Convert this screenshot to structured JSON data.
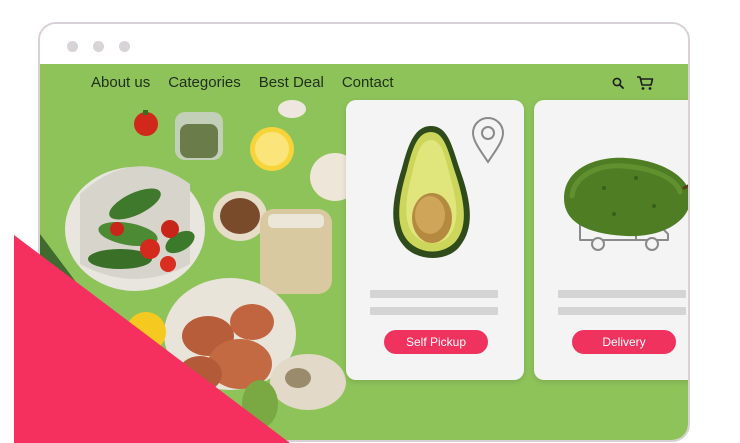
{
  "nav": {
    "items": [
      "About us",
      "Categories",
      "Best Deal",
      "Contact"
    ]
  },
  "icons": {
    "search": "search-icon",
    "cart": "cart-icon",
    "location": "location-pin-icon",
    "truck": "delivery-truck-icon"
  },
  "cards": {
    "pickup_label": "Self Pickup",
    "delivery_label": "Delivery"
  },
  "colors": {
    "page_bg": "#8ec35a",
    "button": "#f0325f",
    "accent_shape": "#f5305f",
    "card": "#f4f4f4"
  }
}
